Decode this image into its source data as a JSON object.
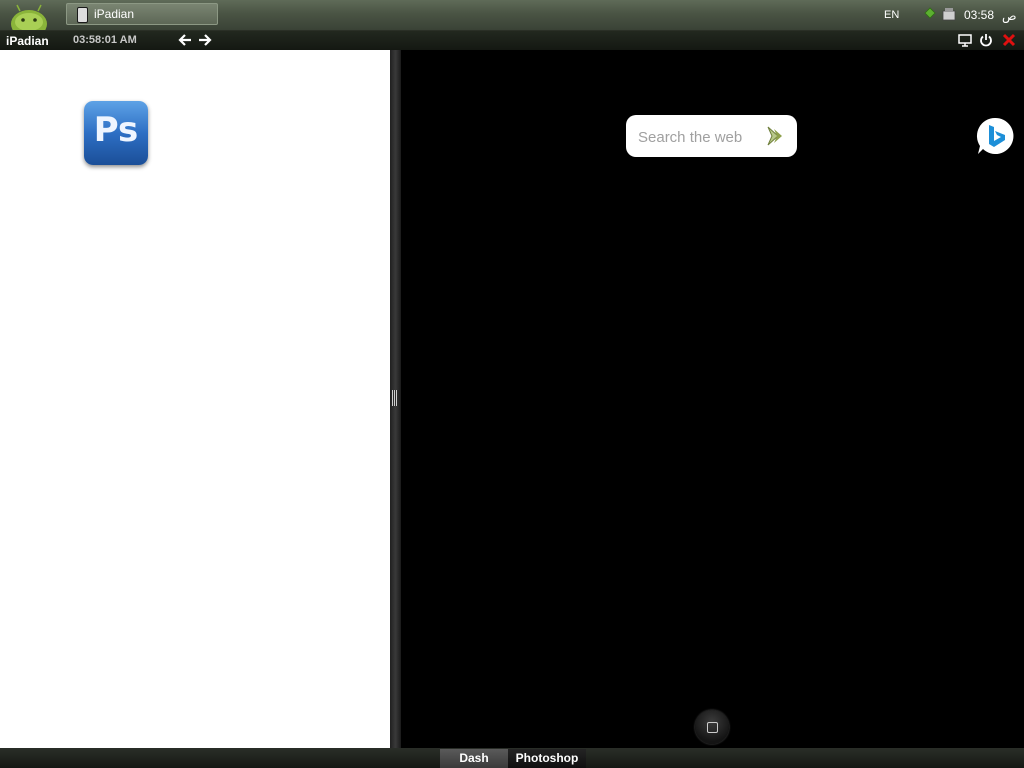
{
  "taskbar": {
    "task_label": "iPadian",
    "tray": {
      "language": "EN",
      "clock": "03:58",
      "ampm": "ص"
    }
  },
  "titlebar": {
    "app_name": "iPadian",
    "time": "03:58:01 AM"
  },
  "desktop": {
    "apps": [
      {
        "icon": "photoshop-icon",
        "glyph": "Ps"
      }
    ]
  },
  "right_panel": {
    "search": {
      "placeholder": "Search the web",
      "value": ""
    }
  },
  "bottombar": {
    "tabs": [
      {
        "label": "Dash",
        "active": true
      },
      {
        "label": "Photoshop",
        "active": false
      }
    ]
  },
  "colors": {
    "taskbar": "#4a5444",
    "android_green": "#8ab43a",
    "close_red": "#e01010",
    "ps_blue": "#2d6fc4",
    "bing_blue": "#1d8fd8"
  }
}
